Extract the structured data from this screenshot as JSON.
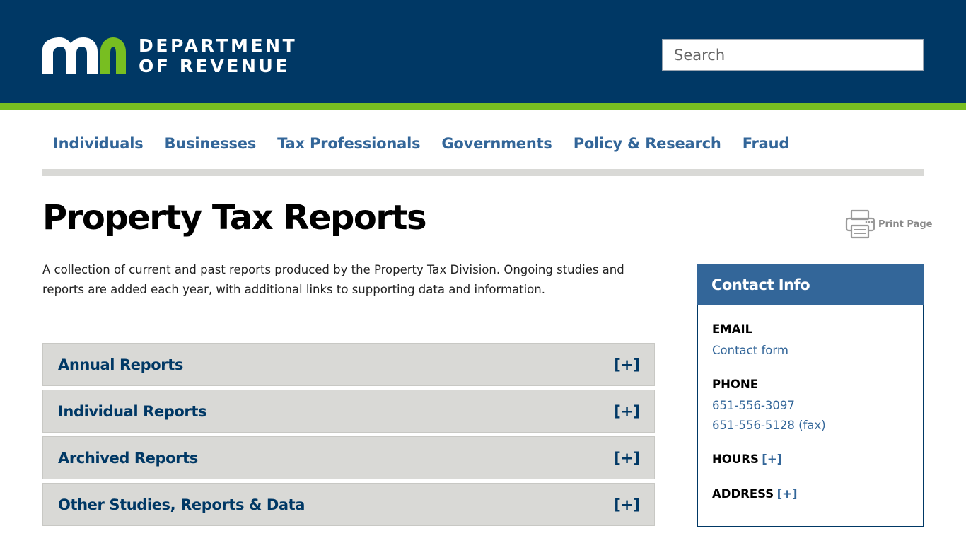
{
  "header": {
    "logo_line1": "DEPARTMENT",
    "logo_line2": "OF REVENUE",
    "search_placeholder": "Search"
  },
  "nav": {
    "items": [
      "Individuals",
      "Businesses",
      "Tax Professionals",
      "Governments",
      "Policy & Research",
      "Fraud"
    ]
  },
  "page": {
    "title": "Property Tax Reports",
    "print_label": "Print Page",
    "intro": "A collection of current and past reports produced by the Property Tax Division. Ongoing studies and reports are added each year, with additional links to supporting data and information."
  },
  "accordion": {
    "toggle": "[+]",
    "items": [
      "Annual Reports",
      "Individual Reports",
      "Archived Reports",
      "Other Studies, Reports & Data"
    ]
  },
  "contact": {
    "heading": "Contact Info",
    "email_label": "EMAIL",
    "email_link": "Contact form",
    "phone_label": "PHONE",
    "phone_1": "651-556-3097",
    "phone_2": "651-556-5128 (fax)",
    "hours_label": "HOURS",
    "address_label": "ADDRESS",
    "toggle": "[+]"
  },
  "colors": {
    "header_bg": "#003865",
    "accent_green": "#78be21",
    "link_blue": "#336699",
    "panel_gray": "#d9d9d6"
  }
}
